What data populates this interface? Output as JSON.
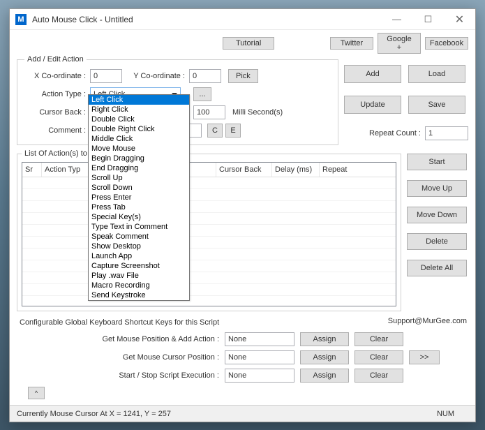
{
  "window": {
    "title": "Auto Mouse Click - Untitled",
    "icon_letter": "M"
  },
  "toprow": {
    "tutorial": "Tutorial",
    "twitter": "Twitter",
    "google": "Google +",
    "facebook": "Facebook"
  },
  "fieldset1": {
    "legend": "Add / Edit Action",
    "x_label": "X Co-ordinate :",
    "x_value": "0",
    "y_label": "Y Co-ordinate :",
    "y_value": "0",
    "pick": "Pick",
    "action_type_label": "Action Type :",
    "action_type_value": "Left Click",
    "ellipsis": "...",
    "cursor_back_label": "Cursor Back :",
    "delay_value": "100",
    "delay_unit": "Milli Second(s)",
    "comment_label": "Comment :",
    "c": "C",
    "e": "E",
    "repeat_label": "Repeat Count :",
    "repeat_value": "1"
  },
  "dropdown": {
    "options": [
      "Left Click",
      "Right Click",
      "Double Click",
      "Double Right Click",
      "Middle Click",
      "Move Mouse",
      "Begin Dragging",
      "End Dragging",
      "Scroll Up",
      "Scroll Down",
      "Press Enter",
      "Press Tab",
      "Special Key(s)",
      "Type Text in Comment",
      "Speak Comment",
      "Show Desktop",
      "Launch App",
      "Capture Screenshot",
      "Play .wav File",
      "Macro Recording",
      "Send Keystroke"
    ]
  },
  "rightbtns": {
    "add": "Add",
    "load": "Load",
    "update": "Update",
    "save": "Save"
  },
  "fieldset2": {
    "legend": "List Of Action(s) to",
    "cols": {
      "sr": "Sr",
      "action": "Action Typ",
      "cursor": "Cursor Back",
      "delay": "Delay (ms)",
      "repeat": "Repeat"
    }
  },
  "listbtns": {
    "start": "Start",
    "moveup": "Move Up",
    "movedown": "Move Down",
    "delete": "Delete",
    "deleteall": "Delete All"
  },
  "shortcuts": {
    "heading": "Configurable Global Keyboard Shortcut Keys for this Script",
    "support": "Support@MurGee.com",
    "row1_label": "Get Mouse Position & Add Action :",
    "row2_label": "Get Mouse Cursor Position :",
    "row3_label": "Start / Stop Script Execution :",
    "none": "None",
    "assign": "Assign",
    "clear": "Clear",
    "more": ">>"
  },
  "caret": "^",
  "statusbar": {
    "text": "Currently Mouse Cursor At X = 1241, Y = 257",
    "num": "NUM"
  }
}
